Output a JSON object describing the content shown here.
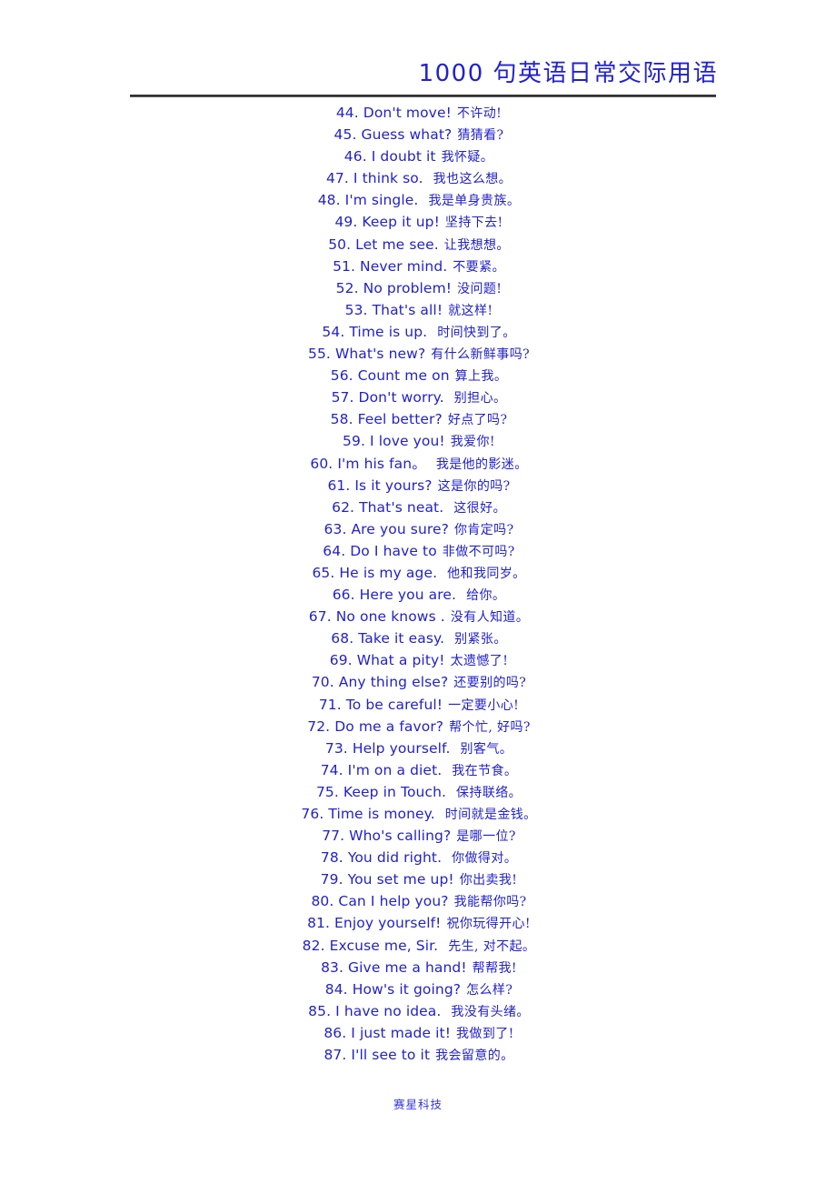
{
  "header": {
    "title": "1000 句英语日常交际用语"
  },
  "footer": {
    "text": "赛星科技"
  },
  "phrases": [
    {
      "num": "44.",
      "en": "Don't move!",
      "zh": "不许动!",
      "gap": "gap-sm"
    },
    {
      "num": "45.",
      "en": "Guess what?",
      "zh": "猜猜看?",
      "gap": "gap-sm"
    },
    {
      "num": "46.",
      "en": "I doubt it",
      "zh": "我怀疑。",
      "gap": "gap-sm"
    },
    {
      "num": "47.",
      "en": "I think so.",
      "zh": "我也这么想。",
      "gap": "gap-md"
    },
    {
      "num": "48.",
      "en": "I'm single.",
      "zh": "我是单身贵族。",
      "gap": "gap-md"
    },
    {
      "num": "49.",
      "en": "Keep it up!",
      "zh": "坚持下去!",
      "gap": "gap-sm"
    },
    {
      "num": "50.",
      "en": "Let me see.",
      "zh": "让我想想。",
      "gap": "gap-sm"
    },
    {
      "num": "51.",
      "en": "Never mind.",
      "zh": "不要紧。",
      "gap": "gap-sm"
    },
    {
      "num": "52.",
      "en": "No problem!",
      "zh": "没问题!",
      "gap": "gap-sm"
    },
    {
      "num": "53.",
      "en": "That's all!",
      "zh": "就这样!",
      "gap": "gap-sm"
    },
    {
      "num": "54.",
      "en": "Time is up.",
      "zh": "时间快到了。",
      "gap": "gap-md"
    },
    {
      "num": "55.",
      "en": "What's new?",
      "zh": "有什么新鲜事吗?",
      "gap": "gap-sm"
    },
    {
      "num": "56.",
      "en": "Count me on",
      "zh": "算上我。",
      "gap": "gap-sm"
    },
    {
      "num": "57.",
      "en": "Don't worry.",
      "zh": "别担心。",
      "gap": "gap-md"
    },
    {
      "num": "58.",
      "en": "Feel better?",
      "zh": "好点了吗?",
      "gap": "gap-sm"
    },
    {
      "num": "59.",
      "en": "I love you!",
      "zh": "我爱你!",
      "gap": "gap-sm"
    },
    {
      "num": "60.",
      "en": "I'm his fan。",
      "zh": "我是他的影迷。",
      "gap": "gap-md"
    },
    {
      "num": "61.",
      "en": "Is it yours?",
      "zh": "这是你的吗?",
      "gap": "gap-sm"
    },
    {
      "num": "62.",
      "en": "That's neat.",
      "zh": "这很好。",
      "gap": "gap-md"
    },
    {
      "num": "63.",
      "en": "Are you sure?",
      "zh": "你肯定吗?",
      "gap": "gap-sm"
    },
    {
      "num": "64.",
      "en": "Do I have to",
      "zh": "非做不可吗?",
      "gap": "gap-sm"
    },
    {
      "num": "65.",
      "en": "He is my age.",
      "zh": "他和我同岁。",
      "gap": "gap-md"
    },
    {
      "num": "66.",
      "en": "Here you are.",
      "zh": "给你。",
      "gap": "gap-md"
    },
    {
      "num": "67.",
      "en": "No one knows .",
      "zh": "没有人知道。",
      "gap": "gap-sm"
    },
    {
      "num": "68.",
      "en": "Take it easy.",
      "zh": "别紧张。",
      "gap": "gap-md"
    },
    {
      "num": "69.",
      "en": "What a pity!",
      "zh": "太遗憾了!",
      "gap": "gap-sm"
    },
    {
      "num": "70.",
      "en": "Any thing else?",
      "zh": "还要别的吗?",
      "gap": "gap-sm"
    },
    {
      "num": "71.",
      "en": "To be careful!",
      "zh": "一定要小心!",
      "gap": "gap-sm"
    },
    {
      "num": "72.",
      "en": "Do me a favor?",
      "zh": "帮个忙, 好吗?",
      "gap": "gap-sm"
    },
    {
      "num": "73.",
      "en": "Help yourself.",
      "zh": "别客气。",
      "gap": "gap-md"
    },
    {
      "num": "74.",
      "en": "I'm on a diet.",
      "zh": "我在节食。",
      "gap": "gap-md"
    },
    {
      "num": "75.",
      "en": "Keep in Touch.",
      "zh": "保持联络。",
      "gap": "gap-md"
    },
    {
      "num": "76.",
      "en": "Time is money.",
      "zh": "时间就是金钱。",
      "gap": "gap-md"
    },
    {
      "num": "77.",
      "en": "Who's calling?",
      "zh": "是哪一位?",
      "gap": "gap-sm"
    },
    {
      "num": "78.",
      "en": "You did right.",
      "zh": "你做得对。",
      "gap": "gap-md"
    },
    {
      "num": "79.",
      "en": "You set me up!",
      "zh": "你出卖我!",
      "gap": "gap-sm"
    },
    {
      "num": "80.",
      "en": "Can I help you?",
      "zh": "我能帮你吗?",
      "gap": "gap-sm"
    },
    {
      "num": "81.",
      "en": "Enjoy yourself!",
      "zh": "祝你玩得开心!",
      "gap": "gap-sm"
    },
    {
      "num": "82.",
      "en": "Excuse me, Sir.",
      "zh": "先生, 对不起。",
      "gap": "gap-md"
    },
    {
      "num": "83.",
      "en": "Give me a hand!",
      "zh": "帮帮我!",
      "gap": "gap-sm"
    },
    {
      "num": "84.",
      "en": "How's it going?",
      "zh": "怎么样?",
      "gap": "gap-sm"
    },
    {
      "num": "85.",
      "en": "I have no idea.",
      "zh": "我没有头绪。",
      "gap": "gap-md"
    },
    {
      "num": "86.",
      "en": "I just made it!",
      "zh": "我做到了!",
      "gap": "gap-sm"
    },
    {
      "num": "87.",
      "en": "I'll see to it",
      "zh": "我会留意的。",
      "gap": "gap-sm"
    }
  ]
}
